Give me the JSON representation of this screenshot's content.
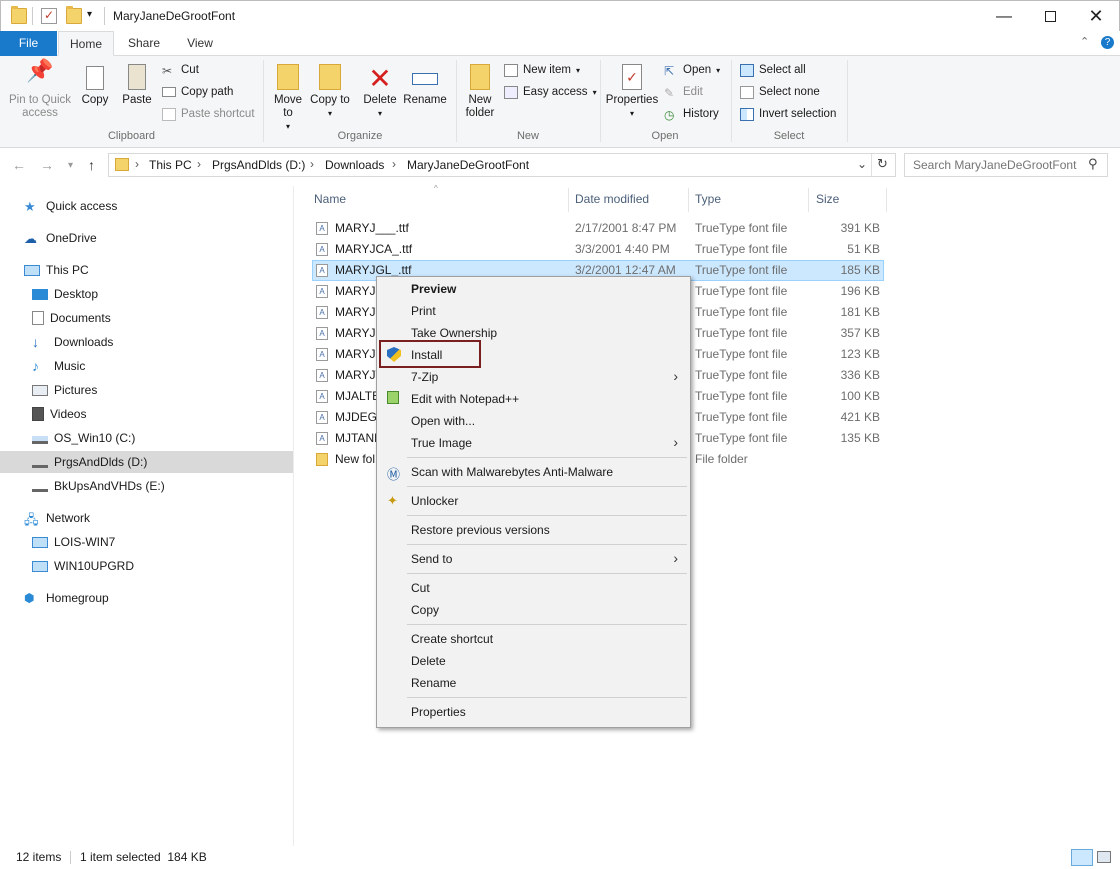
{
  "window": {
    "title": "MaryJaneDeGrootFont"
  },
  "tabs": {
    "file": "File",
    "home": "Home",
    "share": "Share",
    "view": "View"
  },
  "ribbon": {
    "clipboard": {
      "label": "Clipboard",
      "pin": "Pin to Quick access",
      "copy": "Copy",
      "paste": "Paste",
      "cut": "Cut",
      "copy_path": "Copy path",
      "paste_shortcut": "Paste shortcut"
    },
    "organize": {
      "label": "Organize",
      "move_to": "Move to",
      "copy_to": "Copy to",
      "delete": "Delete",
      "rename": "Rename"
    },
    "new": {
      "label": "New",
      "new_folder": "New folder",
      "new_item": "New item",
      "easy_access": "Easy access"
    },
    "open": {
      "label": "Open",
      "properties": "Properties",
      "open": "Open",
      "edit": "Edit",
      "history": "History"
    },
    "select": {
      "label": "Select",
      "select_all": "Select all",
      "select_none": "Select none",
      "invert_selection": "Invert selection"
    }
  },
  "address": {
    "breadcrumbs": [
      "This PC",
      "PrgsAndDlds (D:)",
      "Downloads",
      "MaryJaneDeGrootFont"
    ]
  },
  "search": {
    "placeholder": "Search MaryJaneDeGrootFont"
  },
  "navpane": {
    "items": [
      {
        "label": "Quick access",
        "icon": "star-icon"
      },
      {
        "label": "OneDrive",
        "icon": "cloud-icon"
      },
      {
        "label": "This PC",
        "icon": "computer-icon"
      },
      {
        "label": "Desktop",
        "icon": "desktop-icon"
      },
      {
        "label": "Documents",
        "icon": "documents-icon"
      },
      {
        "label": "Downloads",
        "icon": "download-icon"
      },
      {
        "label": "Music",
        "icon": "music-icon"
      },
      {
        "label": "Pictures",
        "icon": "pictures-icon"
      },
      {
        "label": "Videos",
        "icon": "videos-icon"
      },
      {
        "label": "OS_Win10 (C:)",
        "icon": "drive-icon"
      },
      {
        "label": "PrgsAndDlds (D:)",
        "icon": "drive-icon"
      },
      {
        "label": "BkUpsAndVHDs (E:)",
        "icon": "drive-icon"
      },
      {
        "label": "Network",
        "icon": "network-icon"
      },
      {
        "label": "LOIS-WIN7",
        "icon": "computer-icon"
      },
      {
        "label": "WIN10UPGRD",
        "icon": "computer-icon"
      },
      {
        "label": "Homegroup",
        "icon": "homegroup-icon"
      }
    ]
  },
  "filelist": {
    "columns": {
      "name": "Name",
      "date": "Date modified",
      "type": "Type",
      "size": "Size"
    },
    "rows": [
      {
        "name": "MARYJ___.ttf",
        "date": "2/17/2001 8:47 PM",
        "type": "TrueType font file",
        "size": "391 KB"
      },
      {
        "name": "MARYJCA_.ttf",
        "date": "3/3/2001 4:40 PM",
        "type": "TrueType font file",
        "size": "51 KB"
      },
      {
        "name": "MARYJGL_.ttf",
        "date": "3/2/2001 12:47 AM",
        "type": "TrueType font file",
        "size": "185 KB"
      },
      {
        "name": "MARYJL",
        "date": "",
        "type": "TrueType font file",
        "size": "196 KB"
      },
      {
        "name": "MARYJN",
        "date": "",
        "type": "TrueType font file",
        "size": "181 KB"
      },
      {
        "name": "MARYJO",
        "date": "",
        "type": "TrueType font file",
        "size": "357 KB"
      },
      {
        "name": "MARYJS",
        "date": "",
        "type": "TrueType font file",
        "size": "123 KB"
      },
      {
        "name": "MARYJV",
        "date": "",
        "type": "TrueType font file",
        "size": "336 KB"
      },
      {
        "name": "MJALTE",
        "date": "",
        "type": "TrueType font file",
        "size": "100 KB"
      },
      {
        "name": "MJDEG_",
        "date": "",
        "type": "TrueType font file",
        "size": "421 KB"
      },
      {
        "name": "MJTANK",
        "date": "",
        "type": "TrueType font file",
        "size": "135 KB"
      },
      {
        "name": "New fol",
        "date": "",
        "type": "File folder",
        "size": ""
      }
    ]
  },
  "context_menu": {
    "preview": "Preview",
    "print": "Print",
    "take_ownership": "Take Ownership",
    "install": "Install",
    "seven_zip": "7-Zip",
    "edit_notepad": "Edit with Notepad++",
    "open_with": "Open with...",
    "true_image": "True Image",
    "malwarebytes": "Scan with Malwarebytes Anti-Malware",
    "unlocker": "Unlocker",
    "restore": "Restore previous versions",
    "send_to": "Send to",
    "cut": "Cut",
    "copy": "Copy",
    "create_shortcut": "Create shortcut",
    "delete": "Delete",
    "rename": "Rename",
    "properties": "Properties"
  },
  "status": {
    "count": "12 items",
    "selection": "1 item selected  184 KB"
  },
  "colors": {
    "accent": "#1979ca",
    "selection": "#cce8ff",
    "highlight_box": "#7a1f1f"
  }
}
